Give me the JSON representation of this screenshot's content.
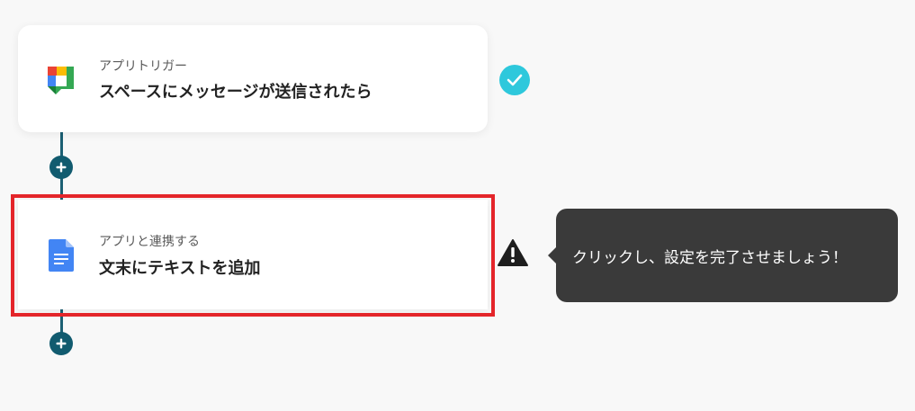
{
  "flow": {
    "trigger": {
      "sub_label": "アプリトリガー",
      "title": "スペースにメッセージが送信されたら",
      "app_icon": "google-chat-icon",
      "status": "complete"
    },
    "action": {
      "sub_label": "アプリと連携する",
      "title": "文末にテキストを追加",
      "app_icon": "google-docs-icon",
      "status": "warning"
    }
  },
  "tooltip": {
    "text": "クリックし、設定を完了させましょう！"
  },
  "colors": {
    "connector": "#1b5f73",
    "plus_button": "#115b6f",
    "highlight_border": "#e4252a",
    "check_badge": "#2ec8dc",
    "tooltip_bg": "#3a3a3a"
  }
}
